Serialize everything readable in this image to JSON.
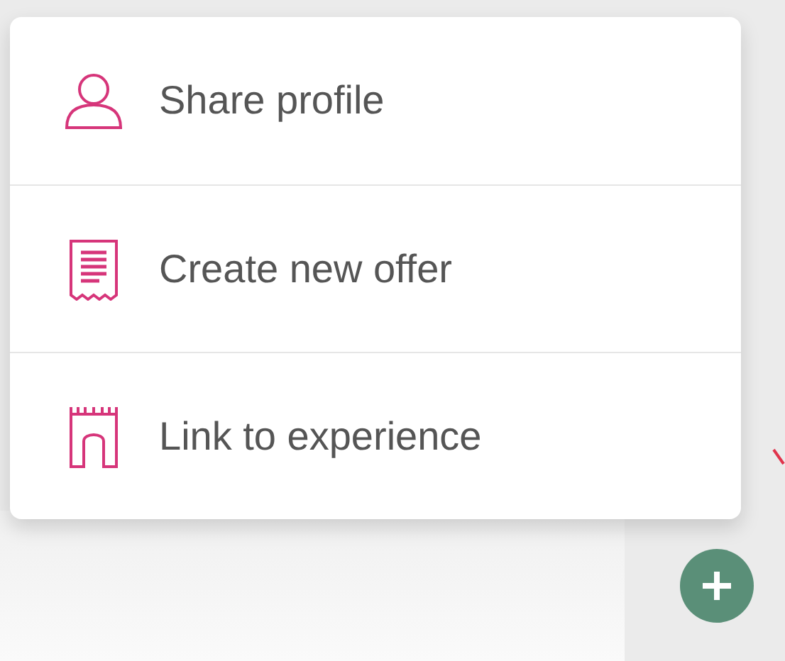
{
  "menu": {
    "items": [
      {
        "kind": "person",
        "label": "Share profile"
      },
      {
        "kind": "receipt",
        "label": "Create new offer"
      },
      {
        "kind": "gate",
        "label": "Link to experience"
      }
    ]
  },
  "fab": {
    "kind": "plus"
  }
}
